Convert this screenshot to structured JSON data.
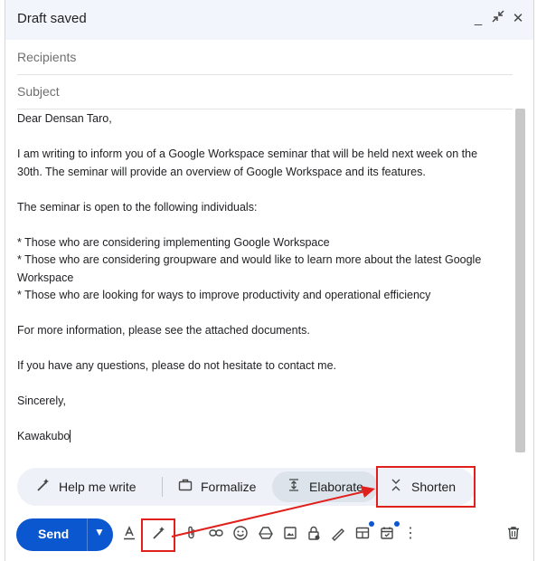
{
  "window": {
    "title": "Draft saved",
    "icons": [
      "minimize-icon",
      "exit-fullscreen-icon",
      "close-icon"
    ]
  },
  "fields": {
    "recipients_placeholder": "Recipients",
    "subject_placeholder": "Subject"
  },
  "body_lines": [
    "Dear Densan Taro,",
    "",
    "I am writing to inform you of a Google Workspace seminar that will be held next week on the 30th. The seminar will provide an overview of Google Workspace and its features.",
    "",
    "The seminar is open to the following individuals:",
    "",
    "* Those who are considering implementing Google Workspace",
    "* Those who are considering groupware and would like to learn more about the latest Google Workspace",
    "* Those who are looking for ways to improve productivity and operational efficiency",
    "",
    "For more information, please see the attached documents.",
    "",
    "If you have any questions, please do not hesitate to contact me.",
    "",
    "Sincerely,",
    "",
    "Kawakubo"
  ],
  "ai_bar": {
    "help_me_write": "Help me write",
    "formalize": "Formalize",
    "elaborate": "Elaborate",
    "shorten": "Shorten"
  },
  "toolbar": {
    "send": "Send",
    "send_button_color": "#0b57d0",
    "annotation_color": "#e0201c",
    "tools": [
      "formatting-icon",
      "help-me-write-icon",
      "attach-icon",
      "link-icon",
      "emoji-icon",
      "drive-icon",
      "photo-icon",
      "lock-icon",
      "signature-icon",
      "layouts-icon",
      "schedule-icon",
      "more-options-icon",
      "delete-icon"
    ]
  }
}
